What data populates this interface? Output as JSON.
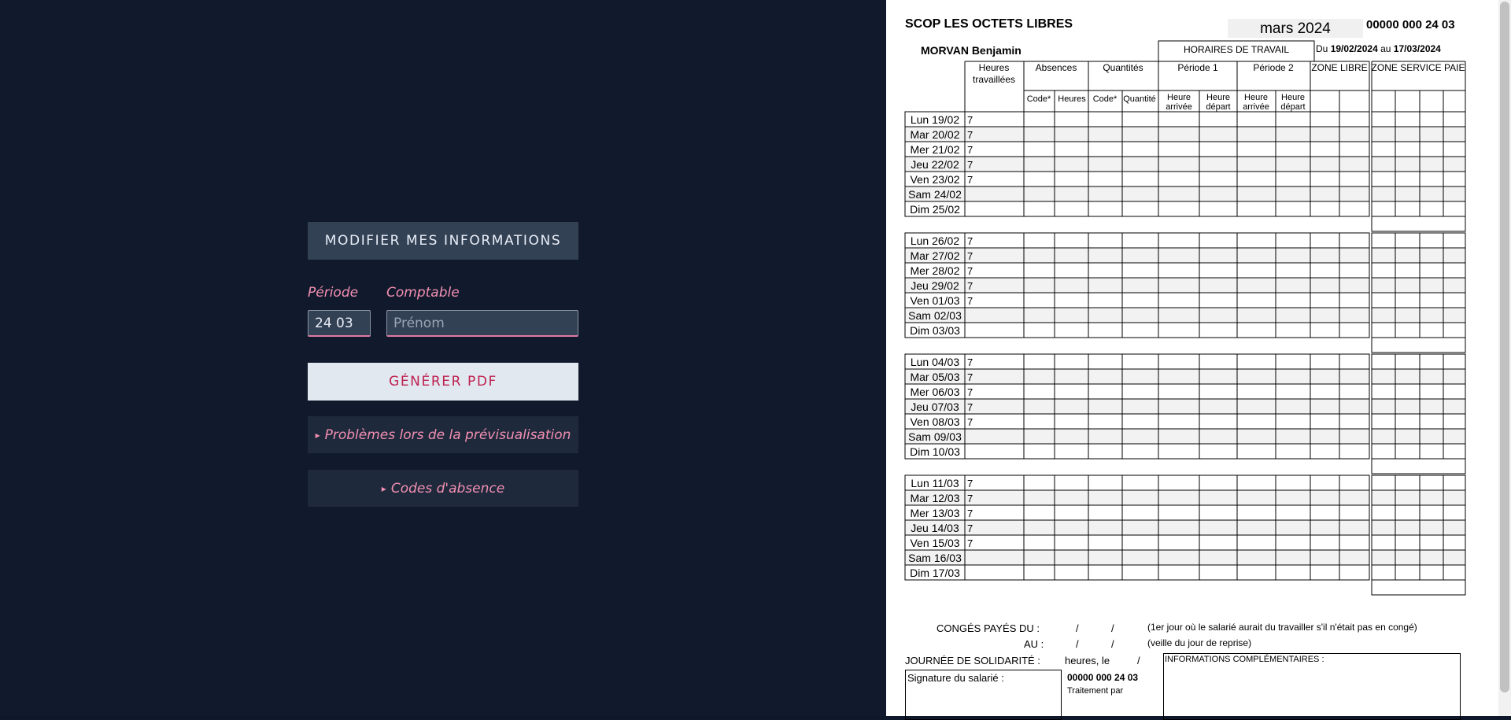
{
  "left_panel": {
    "modify_button": "MODIFIER MES INFORMATIONS",
    "periode_label": "Période",
    "periode_value": "24 03",
    "comptable_label": "Comptable",
    "comptable_placeholder": "Prénom",
    "comptable_value": "",
    "generate_button": "GÉNÉRER PDF",
    "details": [
      {
        "label": "Problèmes lors de la prévisualisation"
      },
      {
        "label": "Codes d'absence"
      }
    ]
  },
  "document": {
    "company": "SCOP LES OCTETS LIBRES",
    "month": "mars 2024",
    "ref_number": "00000 000 24 03",
    "employee": "MORVAN Benjamin",
    "horaires_header": "HORAIRES DE TRAVAIL",
    "period_from_prefix": "Du",
    "period_from": "19/02/2024",
    "period_to_prefix": "au",
    "period_to": "17/03/2024",
    "headers": {
      "heures_travaillees_1": "Heures",
      "heures_travaillees_2": "travaillées",
      "absences": "Absences",
      "quantites": "Quantités",
      "periode1": "Période 1",
      "periode2": "Période 2",
      "zone_libre": "ZONE LIBRE",
      "zone_service_paie": "ZONE SERVICE PAIE",
      "code": "Code*",
      "heures": "Heures",
      "quantite": "Quantité",
      "heure": "Heure",
      "arrivee": "arrivée",
      "depart": "départ"
    },
    "weeks": [
      [
        {
          "day": "Lun 19/02",
          "hours": "7"
        },
        {
          "day": "Mar 20/02",
          "hours": "7"
        },
        {
          "day": "Mer 21/02",
          "hours": "7"
        },
        {
          "day": "Jeu 22/02",
          "hours": "7"
        },
        {
          "day": "Ven 23/02",
          "hours": "7"
        },
        {
          "day": "Sam 24/02",
          "hours": ""
        },
        {
          "day": "Dim 25/02",
          "hours": ""
        }
      ],
      [
        {
          "day": "Lun 26/02",
          "hours": "7"
        },
        {
          "day": "Mar 27/02",
          "hours": "7"
        },
        {
          "day": "Mer 28/02",
          "hours": "7"
        },
        {
          "day": "Jeu 29/02",
          "hours": "7"
        },
        {
          "day": "Ven 01/03",
          "hours": "7"
        },
        {
          "day": "Sam 02/03",
          "hours": ""
        },
        {
          "day": "Dim 03/03",
          "hours": ""
        }
      ],
      [
        {
          "day": "Lun 04/03",
          "hours": "7"
        },
        {
          "day": "Mar 05/03",
          "hours": "7"
        },
        {
          "day": "Mer 06/03",
          "hours": "7"
        },
        {
          "day": "Jeu 07/03",
          "hours": "7"
        },
        {
          "day": "Ven 08/03",
          "hours": "7"
        },
        {
          "day": "Sam 09/03",
          "hours": ""
        },
        {
          "day": "Dim 10/03",
          "hours": ""
        }
      ],
      [
        {
          "day": "Lun 11/03",
          "hours": "7"
        },
        {
          "day": "Mar 12/03",
          "hours": "7"
        },
        {
          "day": "Mer 13/03",
          "hours": "7"
        },
        {
          "day": "Jeu 14/03",
          "hours": "7"
        },
        {
          "day": "Ven 15/03",
          "hours": "7"
        },
        {
          "day": "Sam 16/03",
          "hours": ""
        },
        {
          "day": "Dim 17/03",
          "hours": ""
        }
      ]
    ],
    "footer": {
      "conges_du": "CONGÉS PAYÉS DU :",
      "au": "AU :",
      "slash": "/",
      "conges_note1": "(1er jour où le salarié aurait du travailler s'il n'était pas en congé)",
      "conges_note2": "(veille du jour de reprise)",
      "solidarite": "JOURNÉE DE SOLIDARITÉ :",
      "heures_le": "heures, le",
      "signature": "Signature du salarié :",
      "ref_number": "00000 000 24 03",
      "traitement": "Traitement par",
      "infos": "INFORMATIONS COMPLÉMENTAIRES :"
    }
  }
}
